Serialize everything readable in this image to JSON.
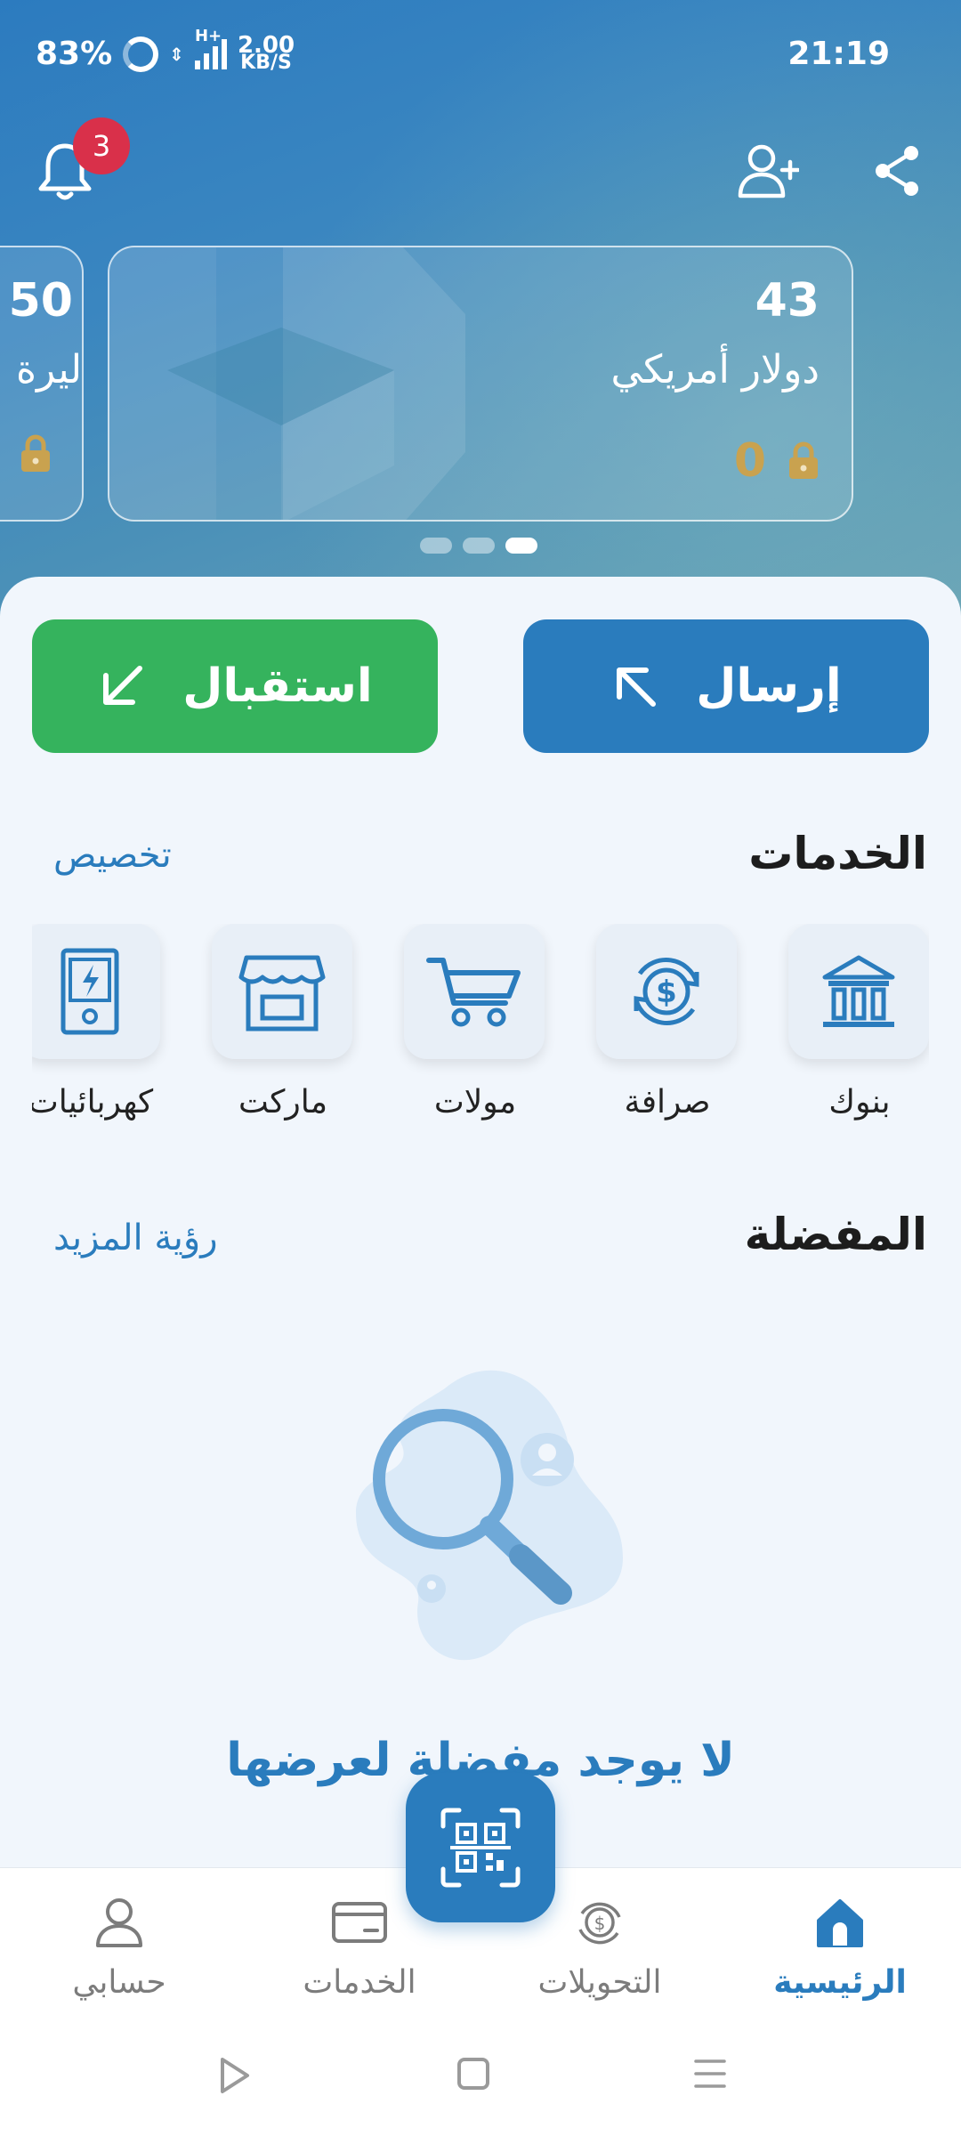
{
  "status_bar": {
    "battery": "83%",
    "network_type": "H+",
    "speed_value": "2.00",
    "speed_unit": "KB/S",
    "time": "21:19"
  },
  "header": {
    "notification_count": "3",
    "icons": [
      "bell-icon",
      "add-user-icon",
      "share-icon"
    ]
  },
  "wallets": {
    "cards": [
      {
        "amount": "43",
        "currency": "دولار أمريكي",
        "locked": "0"
      },
      {
        "amount": "50",
        "currency": "ليرة"
      }
    ],
    "page_count": 3,
    "active_page": 3
  },
  "actions": {
    "send_label": "إرسال",
    "receive_label": "استقبال"
  },
  "services": {
    "title": "الخدمات",
    "customize_label": "تخصيص",
    "items": [
      {
        "label": "بنوك",
        "icon": "bank-icon"
      },
      {
        "label": "صرافة",
        "icon": "currency-exchange-icon"
      },
      {
        "label": "مولات",
        "icon": "cart-icon"
      },
      {
        "label": "ماركت",
        "icon": "store-icon"
      },
      {
        "label": "كهربائيات",
        "icon": "electric-meter-icon"
      }
    ]
  },
  "favorites": {
    "title": "المفضلة",
    "see_more_label": "رؤية المزيد",
    "empty_text": "لا يوجد مفضلة لعرضها"
  },
  "bottom_nav": {
    "items": [
      {
        "label": "الرئيسية",
        "icon": "home-icon",
        "active": true
      },
      {
        "label": "التحويلات",
        "icon": "transfers-icon",
        "active": false
      },
      {
        "label": "الخدمات",
        "icon": "card-icon",
        "active": false
      },
      {
        "label": "حسابي",
        "icon": "person-icon",
        "active": false
      }
    ],
    "fab_icon": "qr-scan-icon"
  },
  "colors": {
    "primary": "#2a7cbd",
    "receive": "#35b35d",
    "badge": "#d9304a",
    "locked": "#c9a24f"
  }
}
